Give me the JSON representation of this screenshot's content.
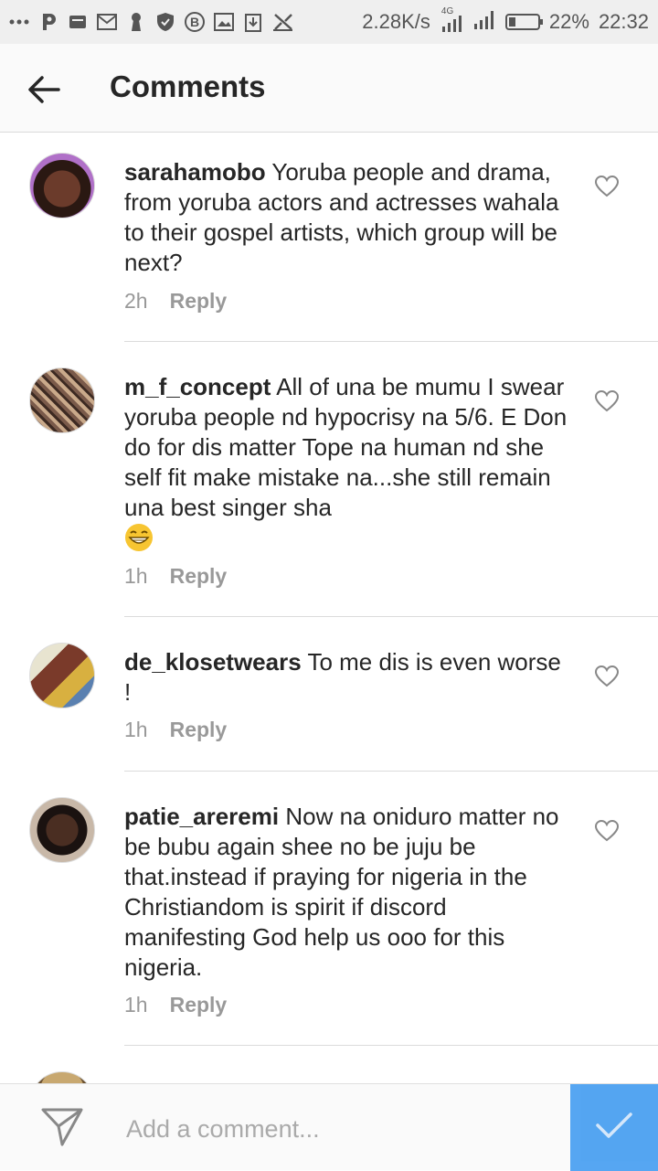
{
  "status_bar": {
    "network_speed": "2.28K/s",
    "network_type": "4G",
    "battery": "22%",
    "battery_level": 0.22,
    "time": "22:32",
    "notification_icons": [
      "more-icon",
      "p-icon",
      "message-icon",
      "mail-icon",
      "keyhole-icon",
      "shield-icon",
      "bitcoin-icon",
      "image-icon",
      "download-icon",
      "crossed-icon"
    ]
  },
  "header": {
    "title": "Comments",
    "back_icon": "arrow-left-icon"
  },
  "comments": [
    {
      "username": "sarahamobo",
      "text": "Yoruba people and drama, from  yoruba actors and actresses wahala to their gospel artists, which group will be next?",
      "time": "2h",
      "reply_label": "Reply"
    },
    {
      "username": "m_f_concept",
      "text": "All of una be mumu I swear yoruba people nd hypocrisy na 5/6. E Don do for dis matter Tope na human nd she self fit make mistake na...she still remain una best singer sha",
      "emoji": "grinning-face-emoji",
      "time": "1h",
      "reply_label": "Reply"
    },
    {
      "username": "de_klosetwears",
      "text": "To me dis is even worse !",
      "time": "1h",
      "reply_label": "Reply"
    },
    {
      "username": "patie_areremi",
      "text": "Now na oniduro matter no be bubu again shee no be juju be that.instead if praying for nigeria in the Christiandom is  spirit if discord manifesting God help us ooo for  this nigeria.",
      "time": "1h",
      "reply_label": "Reply"
    }
  ],
  "composer": {
    "placeholder": "Add a comment...",
    "send_icon": "paper-plane-icon",
    "post_icon": "checkmark-icon"
  },
  "colors": {
    "accent": "#3897f0",
    "text": "#262626",
    "muted": "#999999"
  }
}
